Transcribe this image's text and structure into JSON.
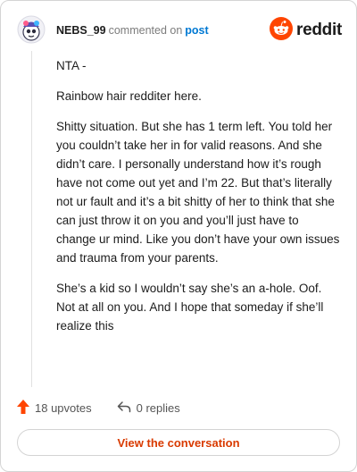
{
  "header": {
    "username": "NEBS_99",
    "action_text": "commented on",
    "post_link": "post",
    "brand": "reddit"
  },
  "comment": {
    "paragraphs": [
      "NTA -",
      "Rainbow hair redditer here.",
      "Shitty situation. But she has 1 term left. You told her you couldn’t take her in for valid reasons. And she didn’t care. I personally understand how it’s rough have not come out yet and I’m 22. But that’s literally not ur fault and it’s a bit shitty of her to think that she can just throw it on you and you’ll just have to change ur mind. Like you don’t have your own issues and trauma from your parents.",
      "She’s a kid so I wouldn’t say she’s an a-hole. Oof. Not at all on you. And I hope that someday if she’ll realize this"
    ]
  },
  "actions": {
    "upvotes": "18 upvotes",
    "replies": "0 replies"
  },
  "footer": {
    "view_label": "View the conversation"
  },
  "colors": {
    "upvote": "#ff4500",
    "link": "#0079d3",
    "button_text": "#d93a00"
  },
  "icons": {
    "avatar": "avatar",
    "brand": "reddit-snoo-icon",
    "upvote": "upvote-arrow-icon",
    "reply": "reply-arrow-icon"
  }
}
